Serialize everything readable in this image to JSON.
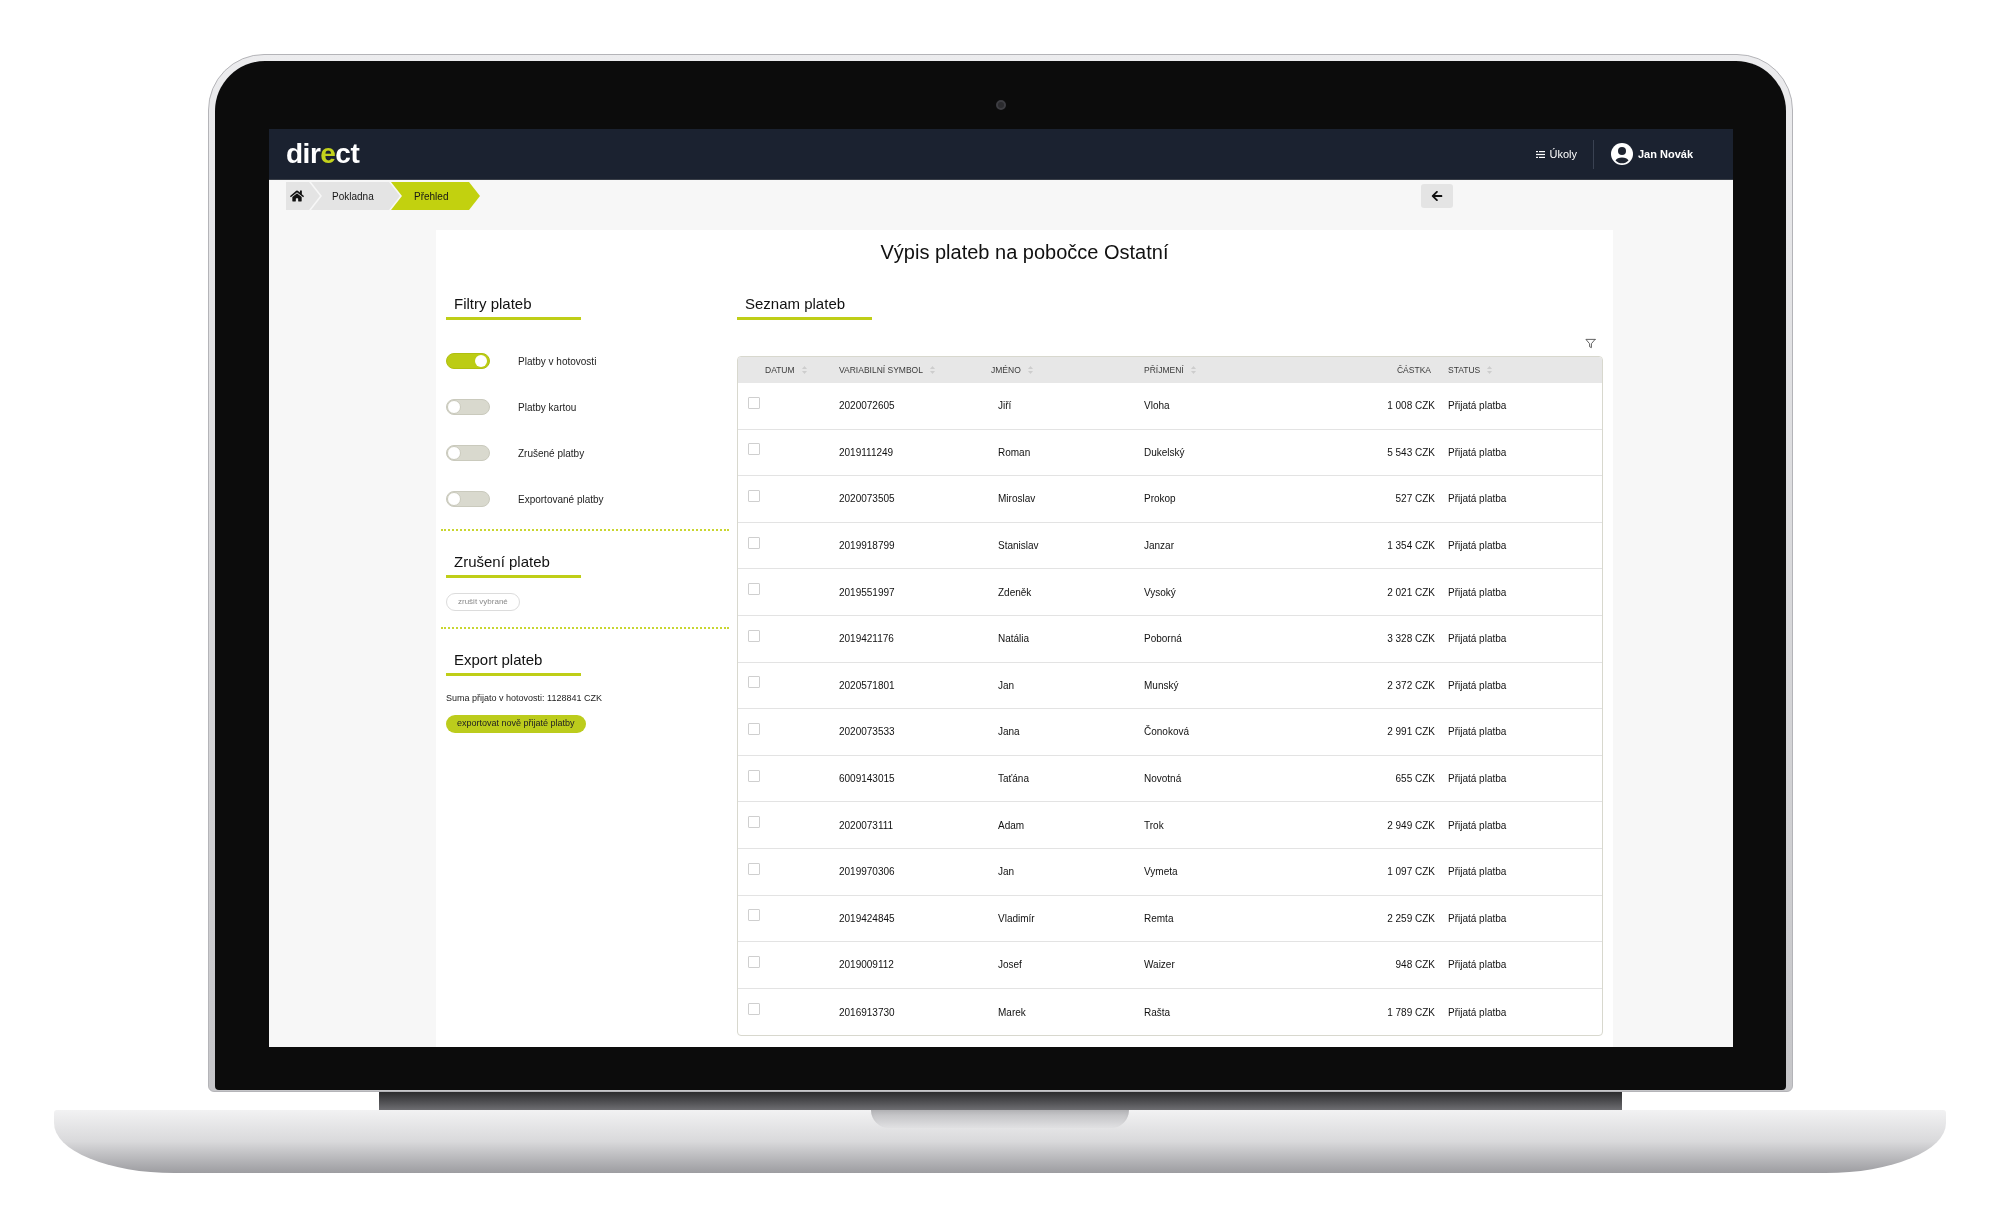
{
  "header": {
    "logo": [
      {
        "text": "dir",
        "accent": false
      },
      {
        "text": "e",
        "accent": true
      },
      {
        "text": "ct",
        "accent": false
      }
    ],
    "tasks_link": "Úkoly",
    "user_name": "Jan Novák"
  },
  "breadcrumbs": [
    {
      "label": "Pokladna",
      "selected": false
    },
    {
      "label": "Přehled",
      "selected": true
    }
  ],
  "page_title": "Výpis plateb na pobočce Ostatní",
  "filters": {
    "title": "Filtry plateb",
    "toggles": [
      {
        "label": "Platby v hotovosti",
        "on": true
      },
      {
        "label": "Platby kartou",
        "on": false
      },
      {
        "label": "Zrušené platby",
        "on": false
      },
      {
        "label": "Exportované platby",
        "on": false
      }
    ]
  },
  "cancel_section": {
    "title": "Zrušení plateb",
    "button": "zrušit vybrané"
  },
  "export_section": {
    "title": "Export plateb",
    "summary": "Suma přijato v hotovosti: 1128841 CZK",
    "button": "exportovat nově přijaté platby"
  },
  "payments": {
    "title": "Seznam plateb",
    "columns": [
      {
        "label": "DATUM",
        "sortable": true
      },
      {
        "label": "VARIABILNÍ SYMBOL",
        "sortable": true
      },
      {
        "label": "JMÉNO",
        "sortable": true
      },
      {
        "label": "PŘÍJMENÍ",
        "sortable": true
      },
      {
        "label": "ČÁSTKA",
        "sortable": false
      },
      {
        "label": "STATUS",
        "sortable": true
      }
    ],
    "rows": [
      {
        "checked": false,
        "variable_symbol": "2020072605",
        "first_name": "Jiří",
        "last_name": "Vloha",
        "amount": "1 008 CZK",
        "status": "Přijatá platba"
      },
      {
        "checked": false,
        "variable_symbol": "2019111249",
        "first_name": "Roman",
        "last_name": "Dukelský",
        "amount": "5 543 CZK",
        "status": "Přijatá platba"
      },
      {
        "checked": false,
        "variable_symbol": "2020073505",
        "first_name": "Miroslav",
        "last_name": "Prokop",
        "amount": "527 CZK",
        "status": "Přijatá platba"
      },
      {
        "checked": false,
        "variable_symbol": "2019918799",
        "first_name": "Stanislav",
        "last_name": "Janzar",
        "amount": "1 354 CZK",
        "status": "Přijatá platba"
      },
      {
        "checked": false,
        "variable_symbol": "2019551997",
        "first_name": "Zdeněk",
        "last_name": "Vysoký",
        "amount": "2 021 CZK",
        "status": "Přijatá platba"
      },
      {
        "checked": false,
        "variable_symbol": "2019421176",
        "first_name": "Natália",
        "last_name": "Poborná",
        "amount": "3 328 CZK",
        "status": "Přijatá platba"
      },
      {
        "checked": false,
        "variable_symbol": "2020571801",
        "first_name": "Jan",
        "last_name": "Munský",
        "amount": "2 372 CZK",
        "status": "Přijatá platba"
      },
      {
        "checked": false,
        "variable_symbol": "2020073533",
        "first_name": "Jana",
        "last_name": "Čonoková",
        "amount": "2 991 CZK",
        "status": "Přijatá platba"
      },
      {
        "checked": false,
        "variable_symbol": "6009143015",
        "first_name": "Taťána",
        "last_name": "Novotná",
        "amount": "655 CZK",
        "status": "Přijatá platba"
      },
      {
        "checked": false,
        "variable_symbol": "2020073111",
        "first_name": "Adam",
        "last_name": "Trok",
        "amount": "2 949 CZK",
        "status": "Přijatá platba"
      },
      {
        "checked": false,
        "variable_symbol": "2019970306",
        "first_name": "Jan",
        "last_name": "Vymeta",
        "amount": "1 097 CZK",
        "status": "Přijatá platba"
      },
      {
        "checked": false,
        "variable_symbol": "2019424845",
        "first_name": "Vladimír",
        "last_name": "Remta",
        "amount": "2 259 CZK",
        "status": "Přijatá platba"
      },
      {
        "checked": false,
        "variable_symbol": "2019009112",
        "first_name": "Josef",
        "last_name": "Waizer",
        "amount": "948 CZK",
        "status": "Přijatá platba"
      },
      {
        "checked": false,
        "variable_symbol": "2016913730",
        "first_name": "Marek",
        "last_name": "Rašta",
        "amount": "1 789 CZK",
        "status": "Přijatá platba"
      }
    ]
  }
}
